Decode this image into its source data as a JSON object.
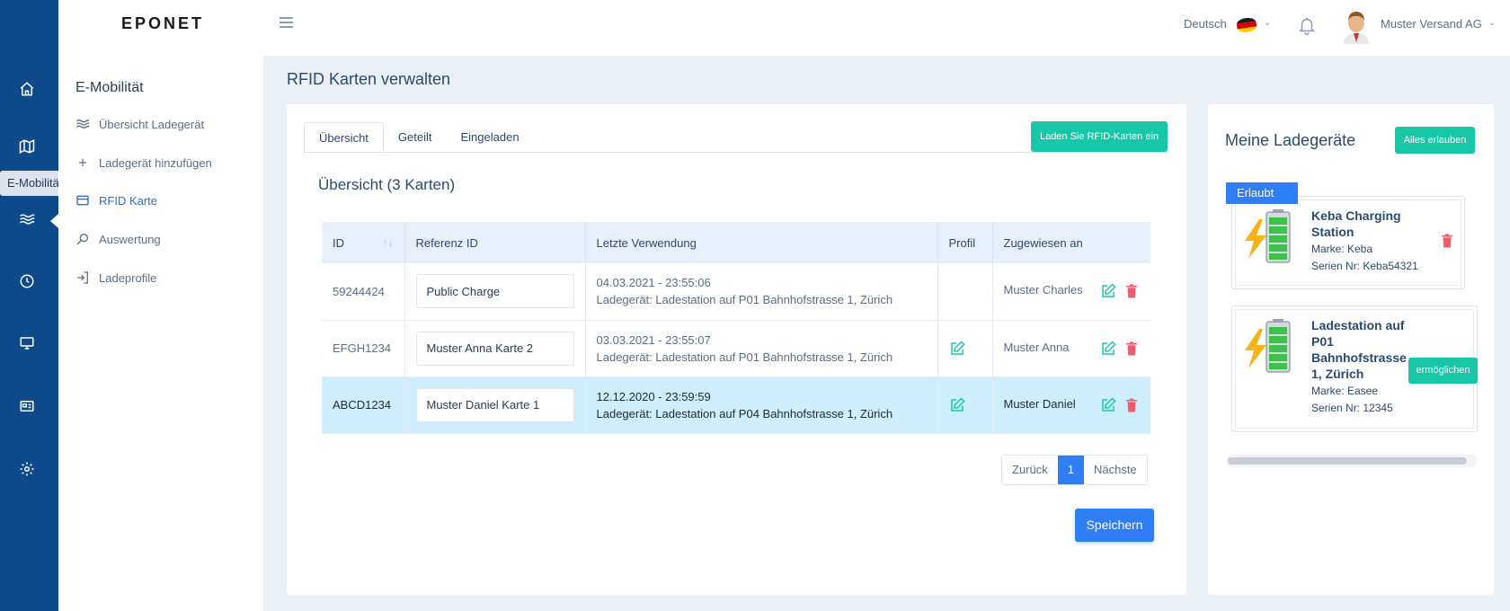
{
  "rail": {
    "tooltip": "E-Mobilität",
    "icons": [
      "home-icon",
      "map-icon",
      "waves-icon",
      "clock-icon",
      "monitor-icon",
      "card-icon",
      "gear-icon"
    ]
  },
  "sidebar": {
    "logo": "EPONET",
    "section_title": "E-Mobilität",
    "items": [
      {
        "label": "Übersicht Ladegerät",
        "icon": "waves-icon"
      },
      {
        "label": "Ladegerät hinzufügen",
        "icon": "plus-icon"
      },
      {
        "label": "RFID Karte",
        "icon": "card-icon",
        "active": true
      },
      {
        "label": "Auswertung",
        "icon": "search-icon"
      },
      {
        "label": "Ladeprofile",
        "icon": "login-icon"
      }
    ]
  },
  "topbar": {
    "language": "Deutsch",
    "user_name": "Muster Versand AG",
    "colors": {
      "flag_black": "#1a1a1a",
      "flag_red": "#dd0000",
      "flag_gold": "#ffce00"
    }
  },
  "page": {
    "title": "RFID Karten verwalten"
  },
  "main": {
    "tabs": [
      {
        "label": "Übersicht",
        "active": true
      },
      {
        "label": "Geteilt"
      },
      {
        "label": "Eingeladen"
      }
    ],
    "load_button": "Laden Sie RFID-Karten ein",
    "subtitle": "Übersicht (3 Karten)",
    "table": {
      "headers": [
        "ID",
        "Referenz ID",
        "Letzte Verwendung",
        "Profil",
        "Zugewiesen an"
      ],
      "rows": [
        {
          "id": "59244424",
          "ref": "Public Charge",
          "date": "04.03.2021 - 23:55:06",
          "charger": "Ladegerät: Ladestation auf P01 Bahnhofstrasse 1, Zürich",
          "profile_edit": false,
          "assigned": "Muster Charles",
          "selected": false
        },
        {
          "id": "EFGH1234",
          "ref": "Muster Anna Karte 2",
          "date": "03.03.2021 - 23:55:07",
          "charger": "Ladegerät: Ladestation auf P01 Bahnhofstrasse 1, Zürich",
          "profile_edit": true,
          "assigned": "Muster Anna",
          "selected": false
        },
        {
          "id": "ABCD1234",
          "ref": "Muster Daniel Karte 1",
          "date": "12.12.2020 - 23:59:59",
          "charger": "Ladegerät: Ladestation auf P04 Bahnhofstrasse 1, Zürich",
          "profile_edit": true,
          "assigned": "Muster Daniel",
          "selected": true
        }
      ]
    },
    "pagination": {
      "prev": "Zurück",
      "page": "1",
      "next": "Nächste"
    },
    "save_button": "Speichern"
  },
  "right": {
    "title": "Meine Ladegeräte",
    "allow_all_button": "Alles erlauben",
    "chargers": [
      {
        "badge": "Erlaubt",
        "name_lines": [
          "Keba Charging",
          "Station"
        ],
        "brand": "Marke: Keba",
        "serial": "Serien Nr: Keba54321"
      },
      {
        "name_lines": [
          "Ladestation auf",
          "P01",
          "Bahnhofstrasse",
          "1, Zürich"
        ],
        "brand": "Marke: Easee",
        "serial": "Serien Nr: 12345",
        "enable_button": "ermöglichen"
      }
    ]
  },
  "colors": {
    "rail": "#0e4a8a",
    "accent_blue": "#2f7ef5",
    "accent_green": "#18c7a6",
    "danger_red": "#f05a6a",
    "selected_row": "#cfeefb"
  }
}
